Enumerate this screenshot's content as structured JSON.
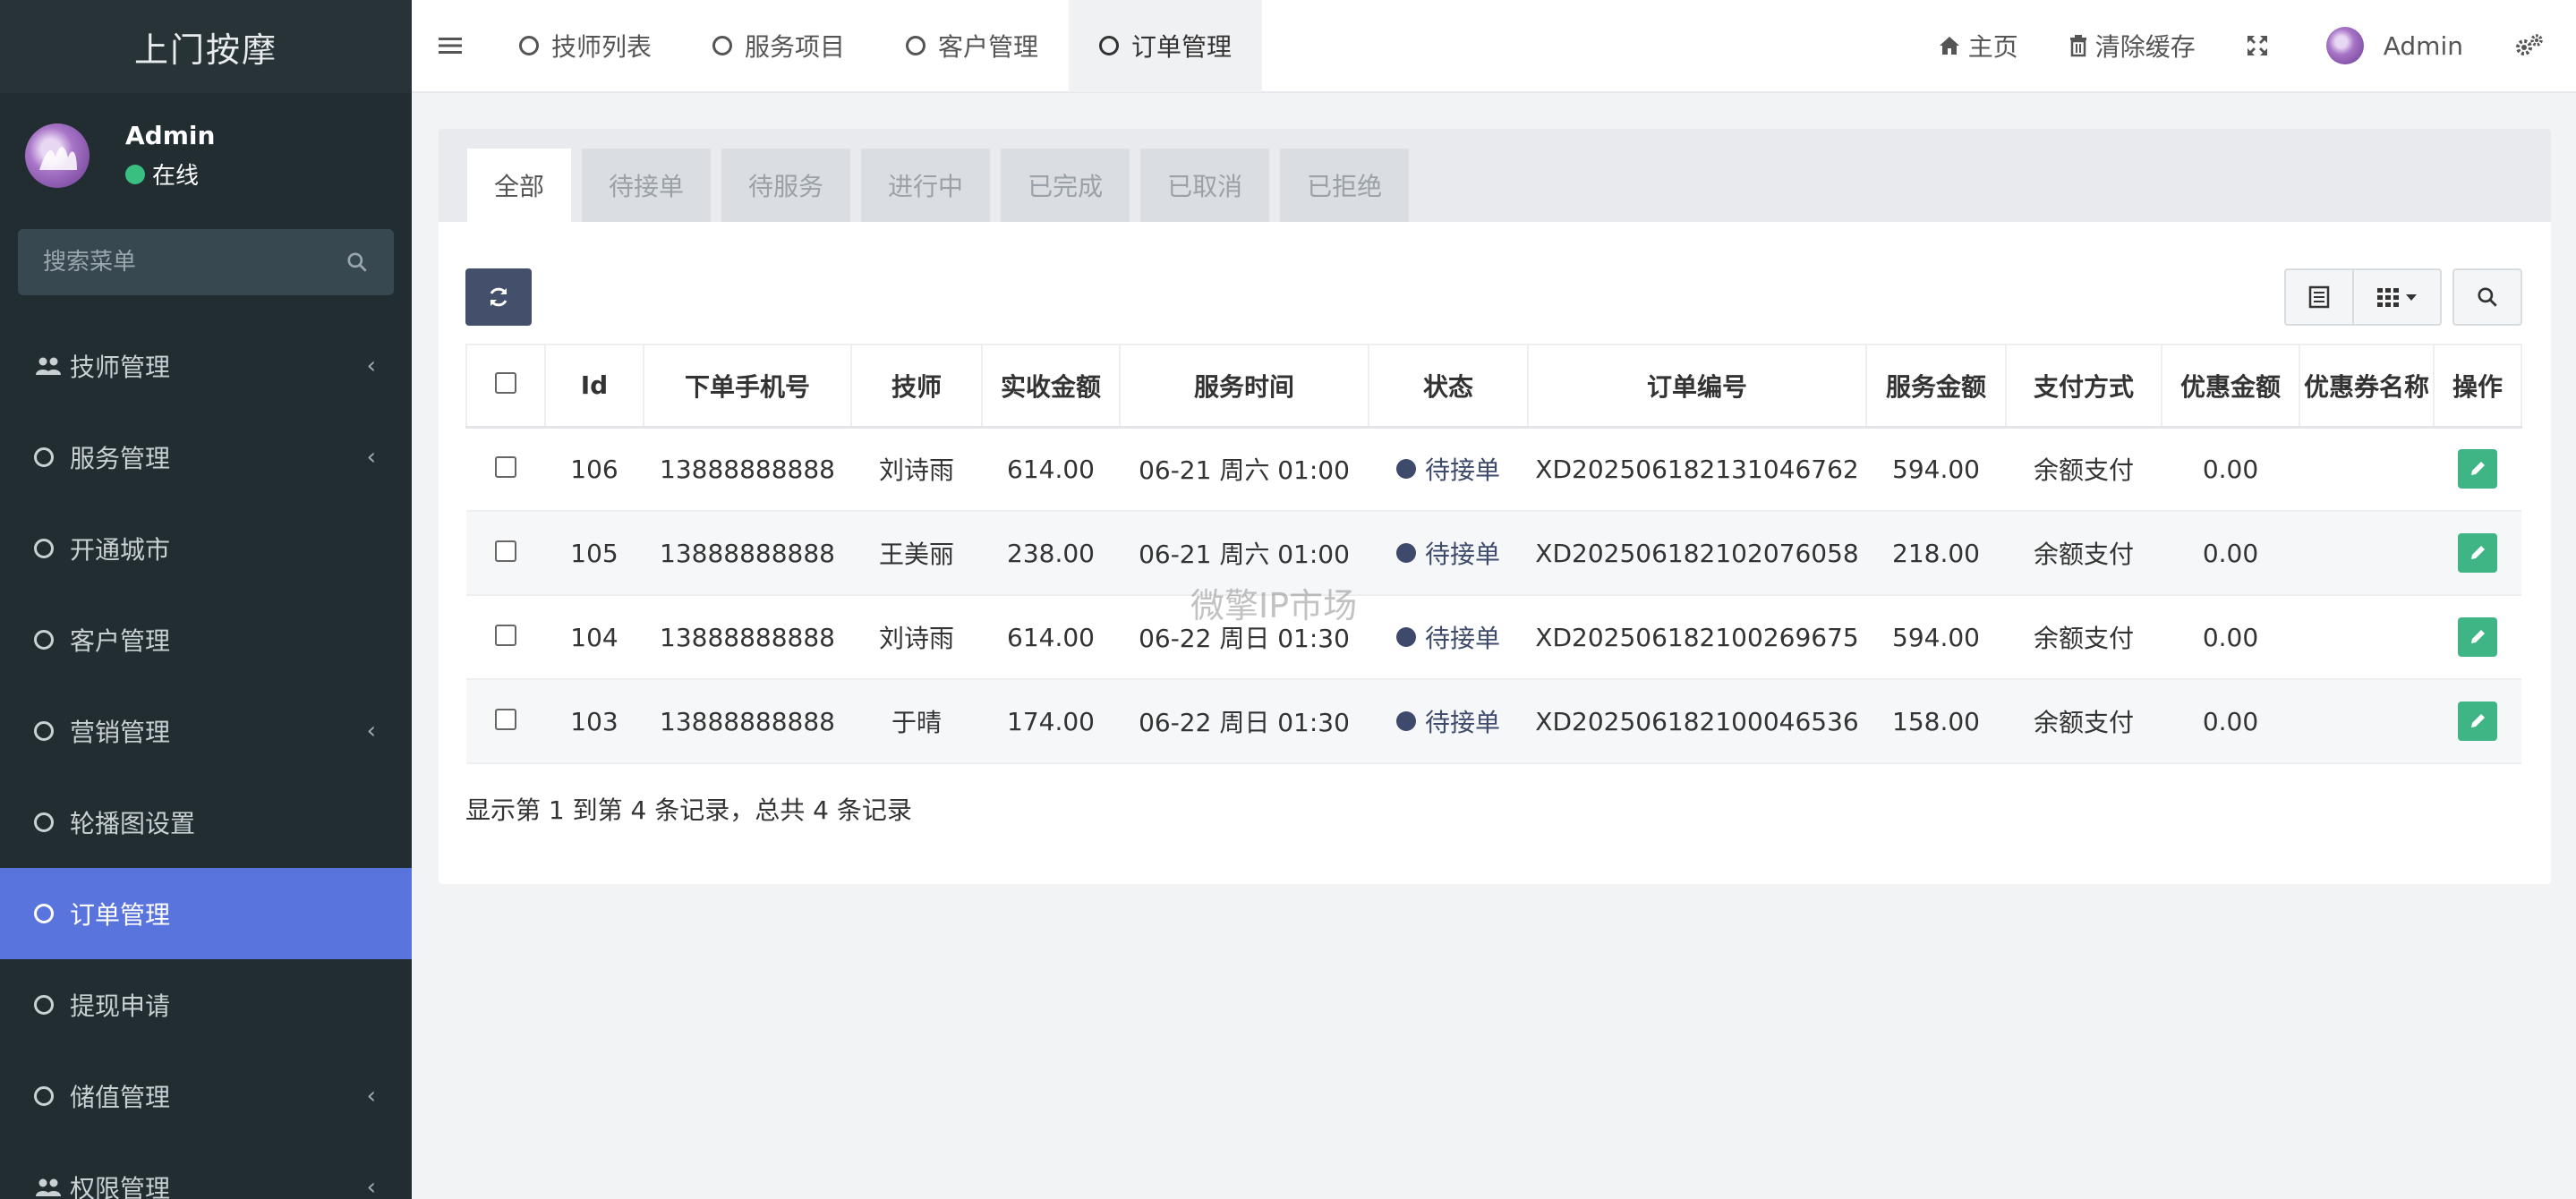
{
  "sidebar": {
    "brand": "上门按摩",
    "user": {
      "name": "Admin",
      "status": "在线"
    },
    "search_placeholder": "搜索菜单",
    "items": [
      {
        "label": "技师管理",
        "icon": "users-icon",
        "chevron": true
      },
      {
        "label": "服务管理",
        "icon": "circle-icon",
        "chevron": true
      },
      {
        "label": "开通城市",
        "icon": "circle-icon",
        "chevron": false
      },
      {
        "label": "客户管理",
        "icon": "circle-icon",
        "chevron": false
      },
      {
        "label": "营销管理",
        "icon": "circle-icon",
        "chevron": true
      },
      {
        "label": "轮播图设置",
        "icon": "circle-icon",
        "chevron": false
      },
      {
        "label": "订单管理",
        "icon": "circle-icon",
        "chevron": false,
        "active": true
      },
      {
        "label": "提现申请",
        "icon": "circle-icon",
        "chevron": false
      },
      {
        "label": "储值管理",
        "icon": "circle-icon",
        "chevron": true
      },
      {
        "label": "权限管理",
        "icon": "users-icon",
        "chevron": true
      }
    ]
  },
  "topnav": {
    "tabs": [
      {
        "label": "技师列表"
      },
      {
        "label": "服务项目"
      },
      {
        "label": "客户管理"
      },
      {
        "label": "订单管理",
        "active": true
      }
    ],
    "home": "主页",
    "clear_cache": "清除缓存",
    "user": "Admin"
  },
  "status_tabs": [
    "全部",
    "待接单",
    "待服务",
    "进行中",
    "已完成",
    "已取消",
    "已拒绝"
  ],
  "table": {
    "headers": [
      "Id",
      "下单手机号",
      "技师",
      "实收金额",
      "服务时间",
      "状态",
      "订单编号",
      "服务金额",
      "支付方式",
      "优惠金额",
      "优惠券名称",
      "操作"
    ],
    "rows": [
      {
        "id": "106",
        "phone": "13888888888",
        "tech": "刘诗雨",
        "paid": "614.00",
        "time": "06-21 周六 01:00",
        "status": "待接单",
        "order_no": "XD202506182131046762",
        "amount": "594.00",
        "pay": "余额支付",
        "discount": "0.00",
        "coupon": ""
      },
      {
        "id": "105",
        "phone": "13888888888",
        "tech": "王美丽",
        "paid": "238.00",
        "time": "06-21 周六 01:00",
        "status": "待接单",
        "order_no": "XD202506182102076058",
        "amount": "218.00",
        "pay": "余额支付",
        "discount": "0.00",
        "coupon": ""
      },
      {
        "id": "104",
        "phone": "13888888888",
        "tech": "刘诗雨",
        "paid": "614.00",
        "time": "06-22 周日 01:30",
        "status": "待接单",
        "order_no": "XD202506182100269675",
        "amount": "594.00",
        "pay": "余额支付",
        "discount": "0.00",
        "coupon": ""
      },
      {
        "id": "103",
        "phone": "13888888888",
        "tech": "于晴",
        "paid": "174.00",
        "time": "06-22 周日 01:30",
        "status": "待接单",
        "order_no": "XD202506182100046536",
        "amount": "158.00",
        "pay": "余额支付",
        "discount": "0.00",
        "coupon": ""
      }
    ]
  },
  "pagination_info": "显示第 1 到第 4 条记录，总共 4 条记录",
  "watermark": "微擎IP市场",
  "colors": {
    "sidebar_bg": "#222d32",
    "active_menu": "#5a74de",
    "status_dot": "#3d4a6b",
    "edit_button": "#3fb586"
  }
}
